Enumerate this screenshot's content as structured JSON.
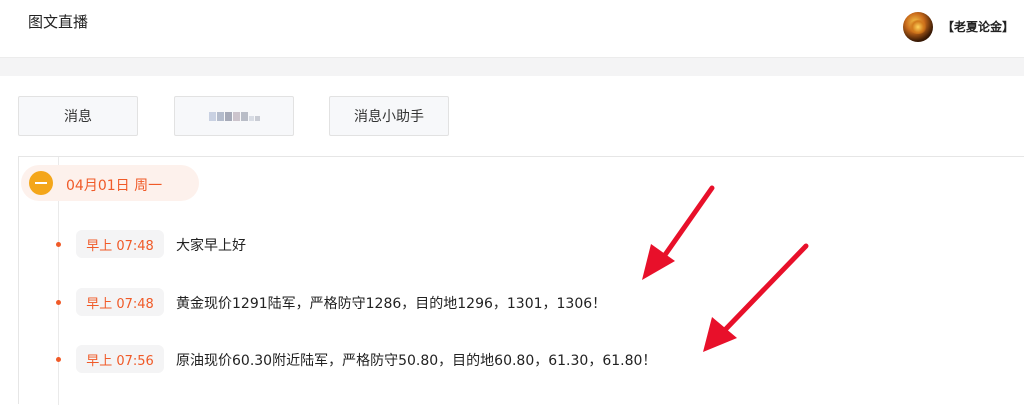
{
  "header": {
    "title": "图文直播",
    "author": "【老夏论金】"
  },
  "tabs": [
    {
      "label": "消息"
    },
    {
      "label": ""
    },
    {
      "label": "消息小助手"
    }
  ],
  "timeline": {
    "date": "04月01日 周一",
    "entries": [
      {
        "time": "早上 07:48",
        "text": "大家早上好"
      },
      {
        "time": "早上 07:48",
        "text": "黄金现价1291陆军，严格防守1286，目的地1296，1301，1306！"
      },
      {
        "time": "早上 07:56",
        "text": "原油现价60.30附近陆军，严格防守50.80，目的地60.80，61.30，61.80！"
      }
    ]
  },
  "colors": {
    "accent": "#f05a28",
    "collapse": "#f4a61a",
    "annotation_arrow": "#e8102a"
  }
}
